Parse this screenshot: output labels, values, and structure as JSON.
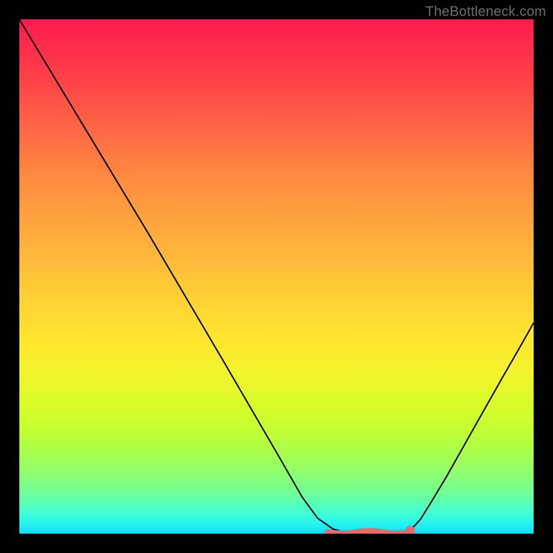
{
  "watermark": "TheBottleneck.com",
  "chart_data": {
    "type": "line",
    "title": "",
    "xlabel": "",
    "ylabel": "",
    "xlim": [
      0,
      100
    ],
    "ylim": [
      0,
      100
    ],
    "grid": false,
    "legend": false,
    "background_gradient": {
      "top": "#ff1a4d",
      "middle": "#ffe02f",
      "bottom": "#1ceaf5"
    },
    "curve": {
      "description": "V-shaped black curve descending from top-left to a flat bottom around x≈65–75, then rising to the right edge",
      "color": "#000000",
      "stroke_width": 2,
      "x": [
        0,
        5,
        10,
        15,
        20,
        25,
        30,
        35,
        40,
        45,
        50,
        55,
        58,
        61,
        64,
        66,
        68,
        70,
        72,
        74,
        76,
        78,
        80,
        83,
        86,
        90,
        94,
        97,
        100
      ],
      "y": [
        100.0,
        91.7,
        83.4,
        75.1,
        66.8,
        58.5,
        50.0,
        41.5,
        33.0,
        24.4,
        15.8,
        7.1,
        3.0,
        0.9,
        0.1,
        0.0,
        0.0,
        0.0,
        0.0,
        0.1,
        0.6,
        2.8,
        6.0,
        11.0,
        16.3,
        23.4,
        30.5,
        35.7,
        41.0
      ]
    },
    "bottom_marker": {
      "description": "short salmon-colored segment sitting at the valley floor",
      "color": "#e86a6a",
      "x_start": 60,
      "x_end": 76,
      "y": 0.2,
      "end_dot": true
    }
  }
}
